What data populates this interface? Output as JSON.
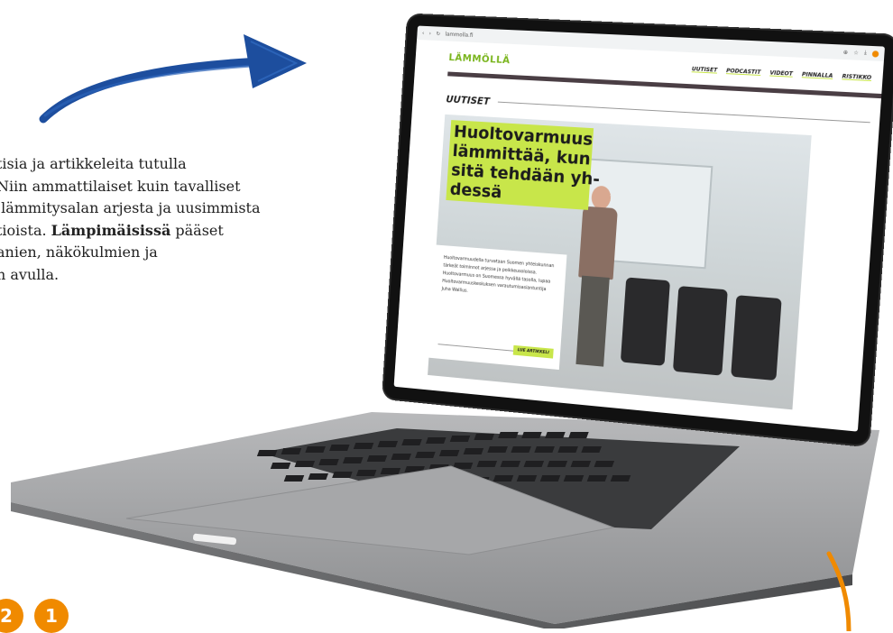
{
  "intro": {
    "line1": "tisia ja artikkeleita tutulla",
    "line2": "Niin ammattilaiset kuin tavalliset",
    "line3": " lämmitysalan arjesta ja uusimmista",
    "line4_pre": "tioista. ",
    "line4_bold": "Lämpimäisissä",
    "line4_post": " pääset",
    "line5": "anien, näkökulmien ja",
    "line6": "n avulla."
  },
  "browser": {
    "url": "lammolla.fi"
  },
  "site": {
    "logo": "LÄMMÖLLÄ",
    "nav": [
      "UUTISET",
      "PODCASTIT",
      "VIDEOT",
      "PINNALLA",
      "RISTIKKO"
    ],
    "section_title": "UUTISET",
    "headline": "Huoltovarmuus\nlämmittää, kun\nsitä tehdään yh-\ndessä",
    "summary": "Huoltovarmuudella turvataan Suomen yhteiskunnan tärkeät toiminnot arjessa ja poikkeusoloissa. Huoltovarmuus on Suomessa hyvällä tasolla, lupaa Huoltovarmuuskeskuksen varautumisasiantuntija Juha Wallius.",
    "read_more": "LUE ARTIKKELI"
  },
  "badges": [
    "2",
    "1"
  ],
  "colors": {
    "accent_green": "#c8e64a",
    "logo_green": "#7ab51d",
    "arrow_blue": "#1d4e9e",
    "arrow_orange": "#f08a00",
    "bar_dark": "#4a3e44"
  }
}
